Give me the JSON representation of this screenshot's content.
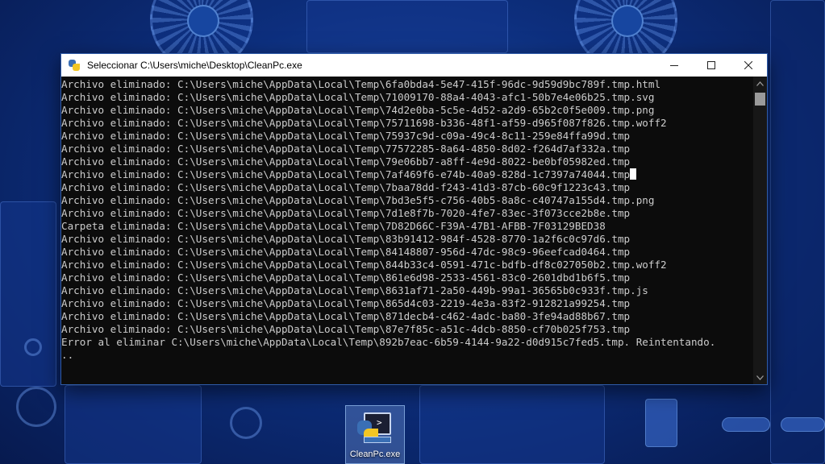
{
  "window": {
    "title": "Seleccionar C:\\Users\\miche\\Desktop\\CleanPc.exe",
    "controls": {
      "minimize": "minimize",
      "maximize": "maximize",
      "close": "close"
    }
  },
  "console": {
    "lines": [
      "Archivo eliminado: C:\\Users\\miche\\AppData\\Local\\Temp\\6fa0bda4-5e47-415f-96dc-9d59d9bc789f.tmp.html",
      "Archivo eliminado: C:\\Users\\miche\\AppData\\Local\\Temp\\71009170-88a4-4043-afc1-50b7e4e06b25.tmp.svg",
      "Archivo eliminado: C:\\Users\\miche\\AppData\\Local\\Temp\\74d2e0ba-5c5e-4d52-a2d9-65b2c0f5e009.tmp.png",
      "Archivo eliminado: C:\\Users\\miche\\AppData\\Local\\Temp\\75711698-b336-48f1-af59-d965f087f826.tmp.woff2",
      "Archivo eliminado: C:\\Users\\miche\\AppData\\Local\\Temp\\75937c9d-c09a-49c4-8c11-259e84ffa99d.tmp",
      "Archivo eliminado: C:\\Users\\miche\\AppData\\Local\\Temp\\77572285-8a64-4850-8d02-f264d7af332a.tmp",
      "Archivo eliminado: C:\\Users\\miche\\AppData\\Local\\Temp\\79e06bb7-a8ff-4e9d-8022-be0bf05982ed.tmp",
      "Archivo eliminado: C:\\Users\\miche\\AppData\\Local\\Temp\\7af469f6-e74b-40a9-828d-1c7397a74044.tmp",
      "Archivo eliminado: C:\\Users\\miche\\AppData\\Local\\Temp\\7baa78dd-f243-41d3-87cb-60c9f1223c43.tmp",
      "Archivo eliminado: C:\\Users\\miche\\AppData\\Local\\Temp\\7bd3e5f5-c756-40b5-8a8c-c40747a155d4.tmp.png",
      "Archivo eliminado: C:\\Users\\miche\\AppData\\Local\\Temp\\7d1e8f7b-7020-4fe7-83ec-3f073cce2b8e.tmp",
      "Carpeta eliminada: C:\\Users\\miche\\AppData\\Local\\Temp\\7D82D66C-F39A-47B1-AFBB-7F03129BED38",
      "Archivo eliminado: C:\\Users\\miche\\AppData\\Local\\Temp\\83b91412-984f-4528-8770-1a2f6c0c97d6.tmp",
      "Archivo eliminado: C:\\Users\\miche\\AppData\\Local\\Temp\\84148807-956d-47dc-98c9-96eefcad0464.tmp",
      "Archivo eliminado: C:\\Users\\miche\\AppData\\Local\\Temp\\844b33c4-0591-471c-bdfb-df8c027050b2.tmp.woff2",
      "Archivo eliminado: C:\\Users\\miche\\AppData\\Local\\Temp\\861e6d98-2533-4561-83c0-2601dbd1b6f5.tmp",
      "Archivo eliminado: C:\\Users\\miche\\AppData\\Local\\Temp\\8631af71-2a50-449b-99a1-36565b0c933f.tmp.js",
      "Archivo eliminado: C:\\Users\\miche\\AppData\\Local\\Temp\\865d4c03-2219-4e3a-83f2-912821a99254.tmp",
      "Archivo eliminado: C:\\Users\\miche\\AppData\\Local\\Temp\\871decb4-c462-4adc-ba80-3fe94ad88b67.tmp",
      "Archivo eliminado: C:\\Users\\miche\\AppData\\Local\\Temp\\87e7f85c-a51c-4dcb-8850-cf70b025f753.tmp",
      "Error al eliminar C:\\Users\\miche\\AppData\\Local\\Temp\\892b7eac-6b59-4144-9a22-d0d915c7fed5.tmp. Reintentando.",
      ".."
    ],
    "cursor_line": 7
  },
  "desktop": {
    "icon_label": "CleanPc.exe"
  },
  "colors": {
    "console_bg": "#0c0c0c",
    "console_fg": "#cccccc",
    "wallpaper": "#0d2f7e"
  }
}
